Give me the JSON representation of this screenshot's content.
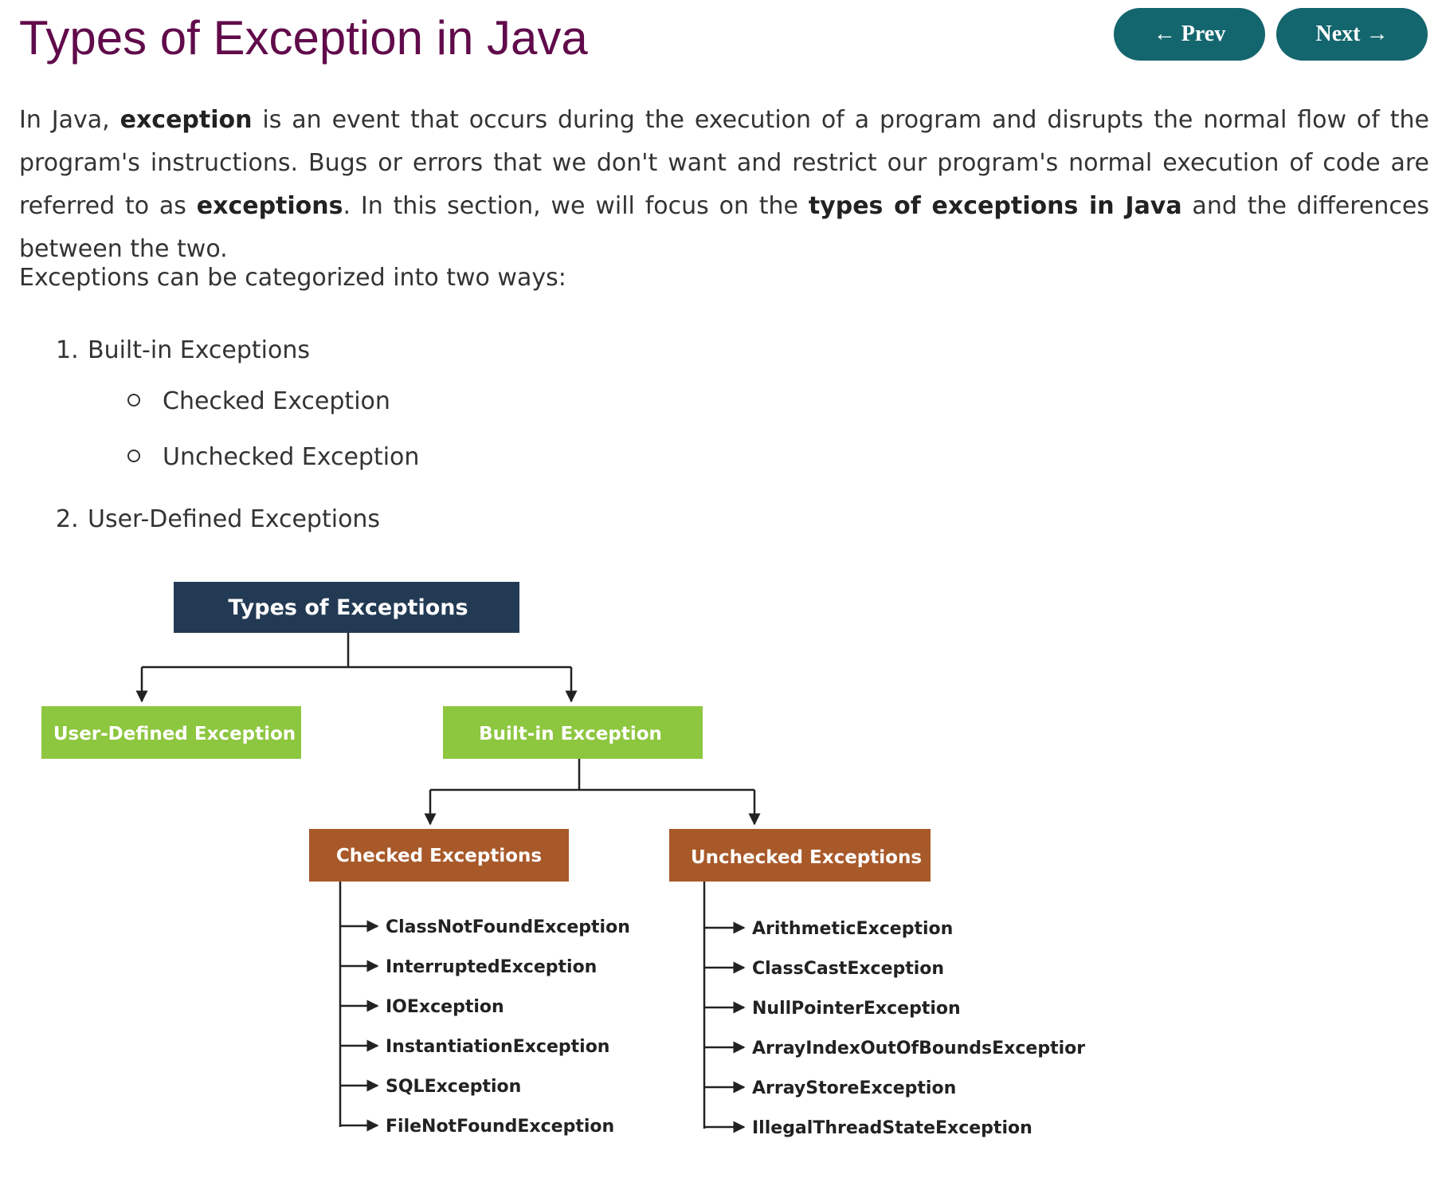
{
  "page": {
    "title": "Types of Exception in Java",
    "prev_label": "← Prev",
    "next_label": "Next →"
  },
  "intro": {
    "p1_a": "In Java, ",
    "p1_b": "exception",
    "p1_c": " is an event that occurs during the execution of a program and disrupts the normal flow of the program's instructions. Bugs or errors that we don't want and restrict our program's normal execution of code are referred to as ",
    "p1_d": "exceptions",
    "p1_e": ". In this section, we will focus on the ",
    "p1_f": "types of exceptions in Java",
    "p1_g": " and the differences between the two.",
    "p2": "Exceptions can be categorized into two ways:"
  },
  "list": {
    "item1_num": "1.",
    "item1_label": "Built-in Exceptions",
    "sub1": "Checked Exception",
    "sub2": "Unchecked Exception",
    "item2_num": "2.",
    "item2_label": "User-Defined Exceptions"
  },
  "diagram": {
    "root": "Types of Exceptions",
    "user_defined": "User-Defined Exception",
    "built_in": "Built-in Exception",
    "checked": "Checked Exceptions",
    "unchecked": "Unchecked Exceptions",
    "checked_items": [
      "ClassNotFoundException",
      "InterruptedException",
      "IOException",
      "InstantiationException",
      "SQLException",
      "FileNotFoundException"
    ],
    "unchecked_items": [
      "ArithmeticException",
      "ClassCastException",
      "NullPointerException",
      "ArrayIndexOutOfBoundsExceptior",
      "ArrayStoreException",
      "IllegalThreadStateException"
    ],
    "colors": {
      "root": "#233A54",
      "green": "#8DC63F",
      "brown": "#A8592A",
      "line": "#222222"
    }
  }
}
